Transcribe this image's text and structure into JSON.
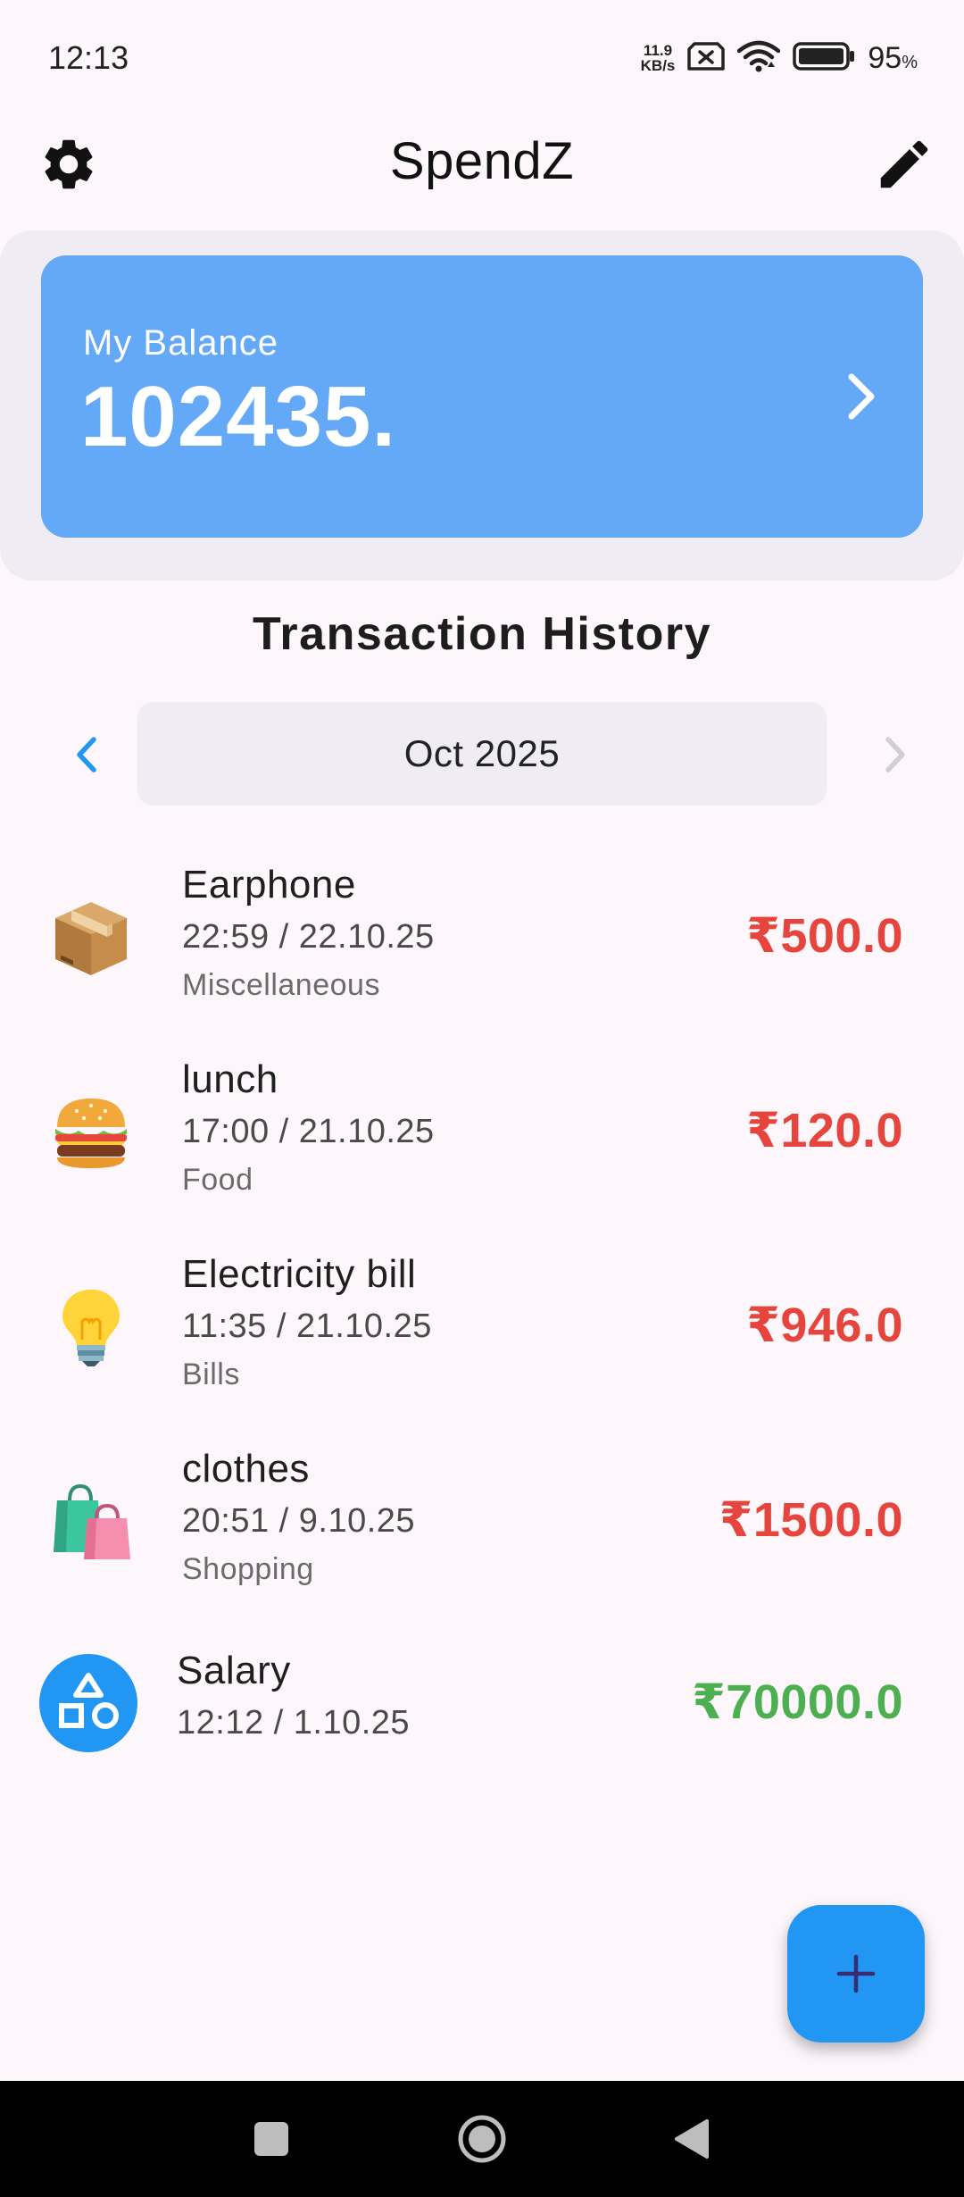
{
  "status_bar": {
    "time": "12:13",
    "net_speed_value": "11.9",
    "net_speed_unit": "KB/s",
    "battery_percent": "95",
    "battery_symbol": "%"
  },
  "app_bar": {
    "title": "SpendZ",
    "left_icon": "gear-icon",
    "right_icon": "pencil-icon"
  },
  "balance": {
    "label": "My Balance",
    "value": "102435.",
    "card_color": "#64a9f7"
  },
  "history": {
    "title": "Transaction History",
    "month": "Oct 2025"
  },
  "transactions": [
    {
      "name": "Earphone",
      "datetime": "22:59 / 22.10.25",
      "category": "Miscellaneous",
      "amount": "₹500.0",
      "type": "expense",
      "icon": "package-icon"
    },
    {
      "name": "lunch",
      "datetime": "17:00 / 21.10.25",
      "category": "Food",
      "amount": "₹120.0",
      "type": "expense",
      "icon": "burger-icon"
    },
    {
      "name": "Electricity bill",
      "datetime": "11:35 / 21.10.25",
      "category": "Bills",
      "amount": "₹946.0",
      "type": "expense",
      "icon": "lightbulb-icon"
    },
    {
      "name": "clothes",
      "datetime": "20:51 / 9.10.25",
      "category": "Shopping",
      "amount": "₹1500.0",
      "type": "expense",
      "icon": "shopping-bags-icon"
    },
    {
      "name": "Salary",
      "datetime": "12:12 / 1.10.25",
      "category": "",
      "amount": "₹70000.0",
      "type": "income",
      "icon": "shapes-icon"
    }
  ],
  "colors": {
    "expense": "#e5453c",
    "income": "#4caf50",
    "accent": "#2196f3",
    "background": "#fdf7fc"
  },
  "fab": {
    "icon": "plus-icon"
  },
  "nav_bar": {
    "buttons": [
      "recents-icon",
      "home-icon",
      "back-icon"
    ]
  }
}
